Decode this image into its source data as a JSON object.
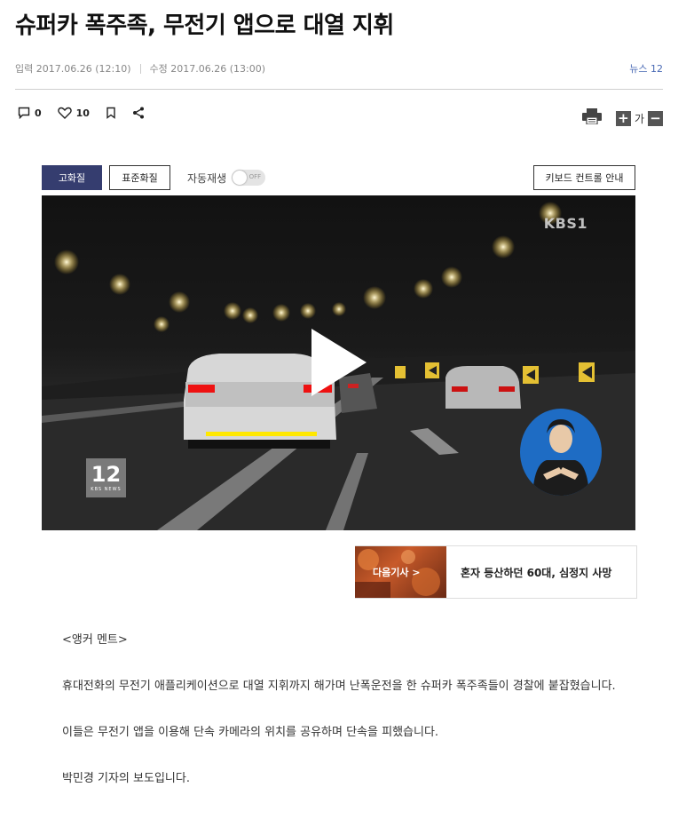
{
  "article": {
    "title": "슈퍼카 폭주족, 무전기 앱으로 대열 지휘",
    "input_time": "입력 2017.06.26 (12:10)",
    "modified_time": "수정 2017.06.26 (13:00)",
    "source": "뉴스 12"
  },
  "tools": {
    "comment_count": "0",
    "like_count": "10",
    "font_label": "가",
    "font_increase": "+",
    "font_decrease": "−"
  },
  "video": {
    "quality_high": "고화질",
    "quality_standard": "표준화질",
    "autoplay_label": "자동재생",
    "autoplay_state": "OFF",
    "keyboard_guide": "키보드 컨트롤 안내",
    "broadcaster_logo": "KBS1",
    "channel_logo": "12",
    "channel_logo_sub": "KBS NEWS"
  },
  "next_article": {
    "label": "다음기사 >",
    "title": "혼자 등산하던 60대, 심정지 사망"
  },
  "body": {
    "p1": "<앵커 멘트>",
    "p2": "휴대전화의 무전기 애플리케이션으로 대열 지휘까지 해가며 난폭운전을 한 슈퍼카 폭주족들이 경찰에 붙잡혔습니다.",
    "p3": "이들은 무전기 앱을 이용해 단속 카메라의 위치를 공유하며 단속을 피했습니다.",
    "p4": "박민경 기자의 보도입니다."
  },
  "icons": [
    "comment-icon",
    "heart-icon",
    "bookmark-icon",
    "share-icon",
    "print-icon",
    "play-icon"
  ]
}
